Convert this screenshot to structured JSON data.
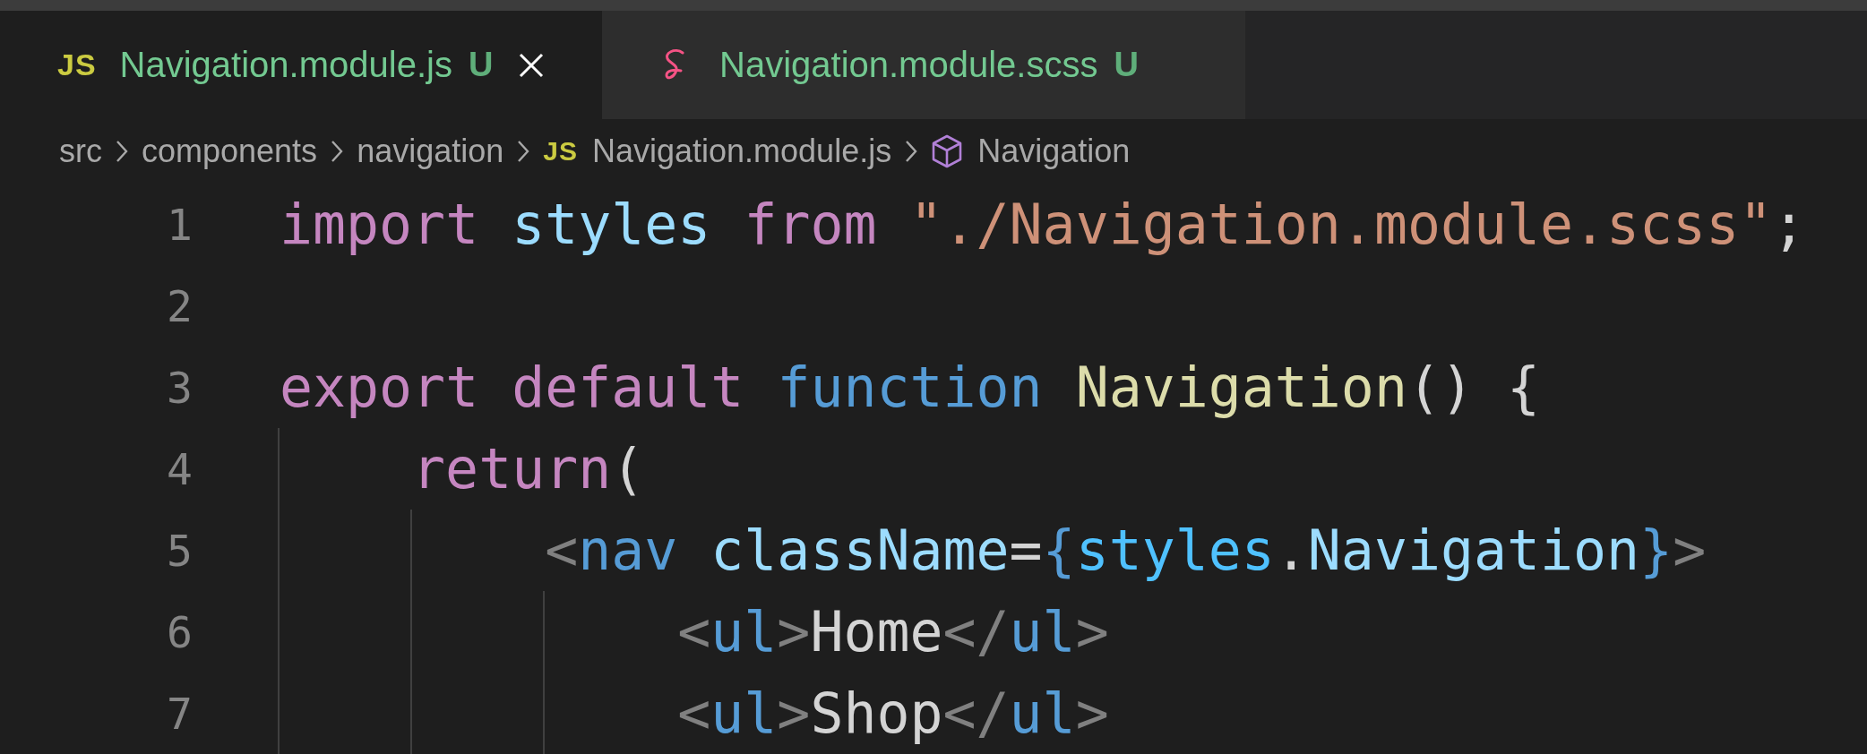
{
  "tabs": [
    {
      "label": "Navigation.module.js",
      "kind": "js",
      "icon_label": "JS",
      "status": "U",
      "selected": true,
      "closable": true
    },
    {
      "label": "Navigation.module.scss",
      "kind": "sass",
      "status": "U",
      "selected": false,
      "closable": false
    }
  ],
  "breadcrumb": [
    {
      "label": "src"
    },
    {
      "label": "components"
    },
    {
      "label": "navigation"
    },
    {
      "label": "Navigation.module.js",
      "kind": "js",
      "icon_label": "JS"
    },
    {
      "label": "Navigation",
      "kind": "symbol"
    }
  ],
  "lines": [
    {
      "number": "1",
      "tokens": [
        {
          "kind": "keyword",
          "text": "import "
        },
        {
          "kind": "variable",
          "text": "styles "
        },
        {
          "kind": "keyword",
          "text": "from "
        },
        {
          "kind": "string",
          "text": "\"./Navigation.module.scss\""
        },
        {
          "kind": "punct",
          "text": ";"
        }
      ]
    },
    {
      "number": "2"
    },
    {
      "number": "3",
      "tokens": [
        {
          "kind": "keyword",
          "text": "export default "
        },
        {
          "kind": "storage",
          "text": "function "
        },
        {
          "kind": "function",
          "text": "Navigation"
        },
        {
          "kind": "punct",
          "text": "() {"
        }
      ],
      "children": [
        {
          "number": "4",
          "tokens": [
            {
              "kind": "keyword",
              "text": "return"
            },
            {
              "kind": "punct",
              "text": "("
            }
          ],
          "children": [
            {
              "number": "5",
              "tokens": [
                {
                  "kind": "bracket",
                  "text": "<"
                },
                {
                  "kind": "tag",
                  "text": "nav "
                },
                {
                  "kind": "variable",
                  "text": "className"
                },
                {
                  "kind": "punct",
                  "text": "="
                },
                {
                  "kind": "tag",
                  "text": "{"
                },
                {
                  "kind": "constant",
                  "text": "styles"
                },
                {
                  "kind": "punct",
                  "text": "."
                },
                {
                  "kind": "variable",
                  "text": "Navigation"
                },
                {
                  "kind": "tag",
                  "text": "}"
                },
                {
                  "kind": "bracket",
                  "text": ">"
                }
              ],
              "children": [
                {
                  "number": "6",
                  "tokens": [
                    {
                      "kind": "bracket",
                      "text": "<"
                    },
                    {
                      "kind": "tag",
                      "text": "ul"
                    },
                    {
                      "kind": "bracket",
                      "text": ">"
                    },
                    {
                      "kind": "punct",
                      "text": "Home"
                    },
                    {
                      "kind": "bracket",
                      "text": "</"
                    },
                    {
                      "kind": "tag",
                      "text": "ul"
                    },
                    {
                      "kind": "bracket",
                      "text": ">"
                    }
                  ]
                },
                {
                  "number": "7",
                  "tokens": [
                    {
                      "kind": "bracket",
                      "text": "<"
                    },
                    {
                      "kind": "tag",
                      "text": "ul"
                    },
                    {
                      "kind": "bracket",
                      "text": ">"
                    },
                    {
                      "kind": "punct",
                      "text": "Shop"
                    },
                    {
                      "kind": "bracket",
                      "text": "</"
                    },
                    {
                      "kind": "tag",
                      "text": "ul"
                    },
                    {
                      "kind": "bracket",
                      "text": ">"
                    }
                  ]
                }
              ]
            }
          ]
        }
      ]
    }
  ]
}
